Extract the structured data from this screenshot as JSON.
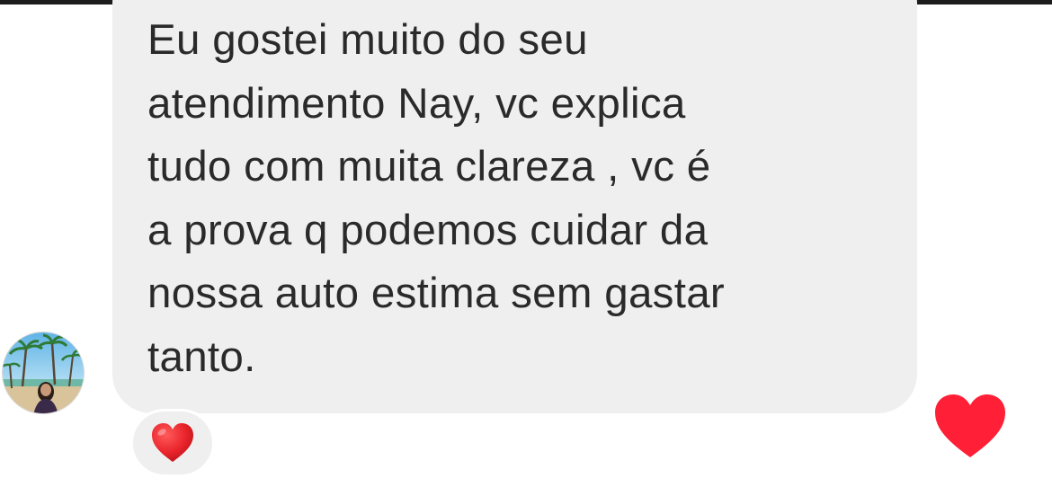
{
  "message": {
    "text": "Eu gostei muito do seu\natendimento Nay, vc explica\ntudo com muita clareza , vc é\na prova q podemos cuidar da\nnossa auto estima sem gastar\ntanto."
  },
  "reaction": {
    "icon": "red-heart-emoji-icon",
    "color": "#e8232a"
  },
  "like_button": {
    "icon": "heart-icon",
    "color": "#ff1f36"
  },
  "avatar": {
    "icon": "profile-avatar"
  },
  "colors": {
    "bubble": "#efefef",
    "text": "#2a2a2a"
  }
}
